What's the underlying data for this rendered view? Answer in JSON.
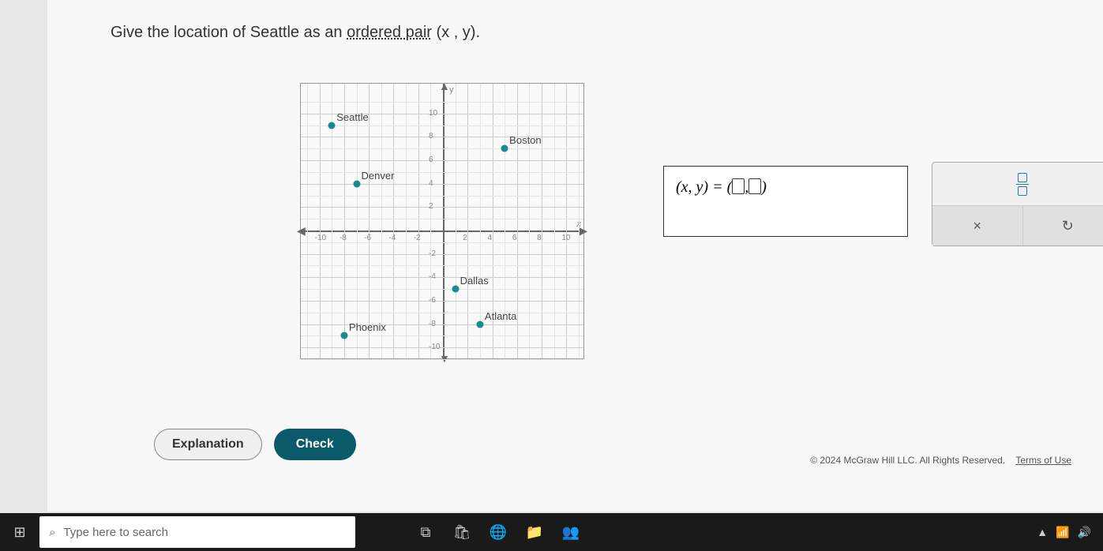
{
  "question": {
    "prefix": "Give the location of Seattle as an ",
    "link_text": "ordered pair",
    "suffix": " (x , y)."
  },
  "chart_data": {
    "type": "scatter",
    "title": "",
    "xlabel": "x",
    "ylabel": "y",
    "xlim": [
      -11,
      11
    ],
    "ylim": [
      -11,
      11
    ],
    "x_ticks": [
      -10,
      -8,
      -6,
      -4,
      -2,
      2,
      4,
      6,
      8,
      10
    ],
    "y_ticks": [
      -10,
      -8,
      -6,
      -4,
      -2,
      2,
      4,
      6,
      8,
      10
    ],
    "series": [
      {
        "name": "Seattle",
        "x": -9,
        "y": 9
      },
      {
        "name": "Boston",
        "x": 5,
        "y": 7
      },
      {
        "name": "Denver",
        "x": -7,
        "y": 4
      },
      {
        "name": "Dallas",
        "x": 1,
        "y": -5
      },
      {
        "name": "Atlanta",
        "x": 3,
        "y": -8
      },
      {
        "name": "Phoenix",
        "x": -8,
        "y": -9
      }
    ]
  },
  "answer": {
    "prefix": "(x, y) = (",
    "separator": ", ",
    "suffix": ")"
  },
  "tools": {
    "clear": "×",
    "reset": "↻"
  },
  "buttons": {
    "explanation": "Explanation",
    "check": "Check"
  },
  "footer": {
    "copyright": "© 2024 McGraw Hill LLC. All Rights Reserved.",
    "terms": "Terms of Use"
  },
  "taskbar": {
    "search_placeholder": "Type here to search"
  }
}
